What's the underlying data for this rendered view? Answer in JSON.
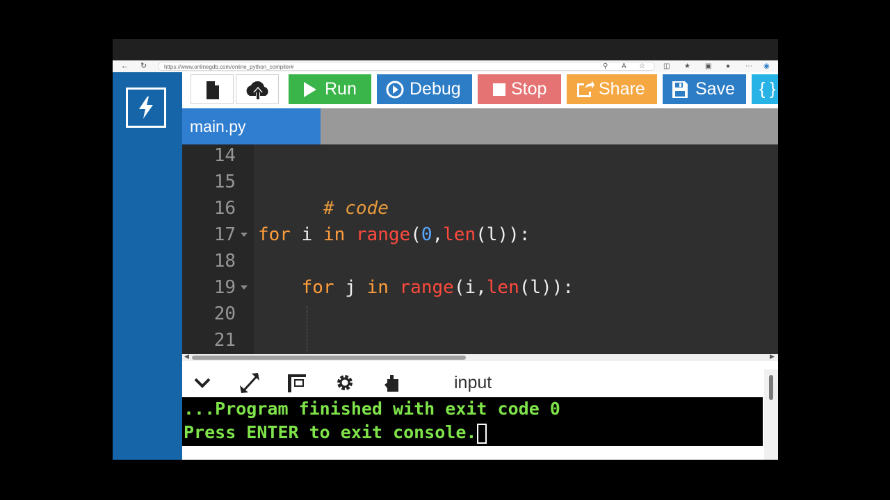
{
  "browser": {
    "url": "https://www.onlinegdb.com/online_python_compiler#"
  },
  "toolbar": {
    "run_label": "Run",
    "debug_label": "Debug",
    "stop_label": "Stop",
    "share_label": "Share",
    "save_label": "Save",
    "beautify_label": "{ }",
    "colors": {
      "run": "#3ab54a",
      "debug": "#2c7cc6",
      "stop": "#e57373",
      "share": "#f5a742",
      "save": "#2c7cc6",
      "beautify": "#27b3e6"
    }
  },
  "tabs": {
    "active_file": "main.py"
  },
  "editor": {
    "line_numbers": [
      "14",
      "15",
      "16",
      "17",
      "18",
      "19",
      "20",
      "21"
    ],
    "code": {
      "comment": "# code",
      "line17": {
        "for": "for",
        "var": " i ",
        "in": "in",
        "range": "range",
        "p1": "(",
        "zero": "0",
        "comma": ",",
        "len": "len",
        "rest": "(l)):"
      },
      "line19": {
        "indent": "    ",
        "for": "for",
        "var": " j ",
        "in": "in",
        "range": "range",
        "p1": "(i,",
        "len": "len",
        "rest": "(l)):"
      }
    }
  },
  "console": {
    "input_label": "input",
    "line1": "...Program finished with exit code 0",
    "line2": "Press ENTER to exit console."
  },
  "icons": {
    "new_file": "file-icon",
    "upload": "cloud-upload-icon",
    "run": "play-icon",
    "debug": "debug-circle-icon",
    "stop": "stop-square-icon",
    "share": "share-icon",
    "save": "floppy-disk-icon",
    "collapse": "chevron-down-icon",
    "expand": "expand-icon",
    "layout": "layout-icon",
    "settings": "gear-icon",
    "clear": "clear-console-icon"
  }
}
